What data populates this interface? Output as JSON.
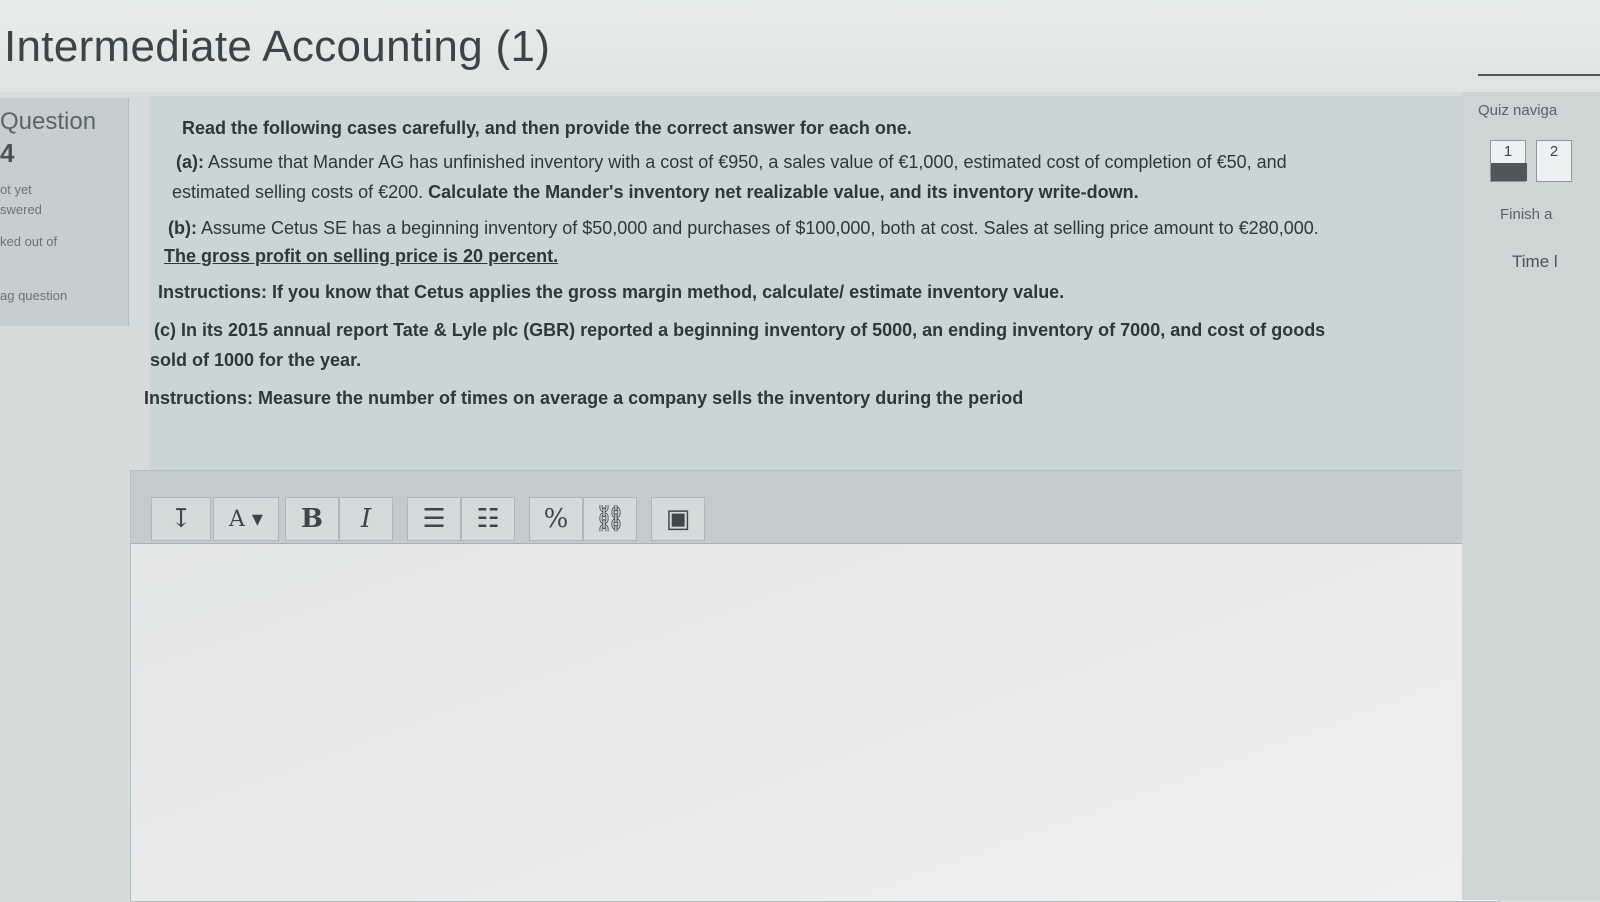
{
  "header": {
    "course_title": "Intermediate Accounting (1)"
  },
  "info": {
    "question_label": "Question",
    "question_number": "4",
    "status_line1": "ot yet",
    "status_line2": "swered",
    "marked": "ked out of",
    "flag": "ag question"
  },
  "question": {
    "intro": "Read the following cases carefully, and then provide the correct answer for each one.",
    "a_label": "(a):",
    "a_text1": " Assume that Mander AG has unfinished inventory with a cost of €950, a sales value of €1,000, estimated cost of completion of €50, and",
    "a_text2": "estimated selling costs of €200. ",
    "a_bold": "Calculate the Mander's inventory net realizable value, and its inventory write-down.",
    "b_label": "(b):",
    "b_text1": " Assume Cetus SE has a beginning inventory of $50,000 and purchases of $100,000, both at cost. Sales at selling price amount to €280,000.",
    "b_underline": "The gross profit on selling price is 20 percent.",
    "b_instructions": "Instructions: If you know that Cetus applies the gross margin method, calculate/ estimate inventory value.",
    "c_text1": "(c) In its 2015 annual report Tate & Lyle plc (GBR) reported a beginning inventory of 5000, an ending inventory of 7000, and cost of goods",
    "c_text2": "sold of 1000 for the year.",
    "c_instructions": "Instructions: Measure the number of times on average a company sells the inventory during the period"
  },
  "toolbar": {
    "buttons": [
      "↧",
      "A ▾",
      "B",
      "I",
      "☰",
      "☷",
      "%",
      "⛓",
      "▣"
    ]
  },
  "nav": {
    "title": "Quiz naviga",
    "btn1": "1",
    "btn2": "2",
    "finish": "Finish a",
    "timer": "Time l"
  }
}
